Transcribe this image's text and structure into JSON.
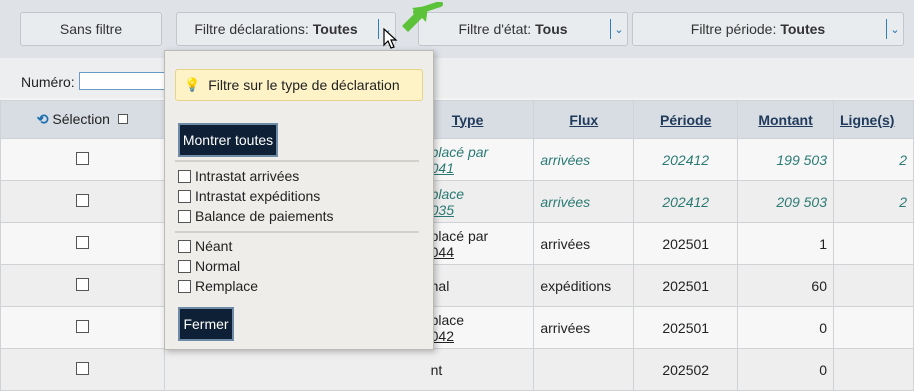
{
  "toolbar": {
    "no_filter": "Sans filtre",
    "decl_label": "Filtre déclarations:",
    "decl_value": "Toutes",
    "state_label": "Filtre d'état:",
    "state_value": "Tous",
    "period_label": "Filtre période:",
    "period_value": "Toutes",
    "chevron": "⌄⌄"
  },
  "number_label": "Numéro:",
  "table": {
    "headers": {
      "selection": "Sélection",
      "type": "Type",
      "flux": "Flux",
      "periode": "Période",
      "montant": "Montant",
      "lignes": "Ligne(s)"
    },
    "rows": [
      {
        "type": "placé par",
        "type2": "041",
        "flux": "arrivées",
        "periode": "202412",
        "montant": "199 503",
        "lignes": "2",
        "italic": true
      },
      {
        "type": "place",
        "type2": "035",
        "flux": "arrivées",
        "periode": "202412",
        "montant": "209 503",
        "lignes": "2",
        "italic": true
      },
      {
        "type": "placé par",
        "type2": "044",
        "flux": "arrivées",
        "periode": "202501",
        "montant": "1",
        "lignes": "",
        "italic": false
      },
      {
        "type": "nal",
        "type2": "",
        "flux": "expéditions",
        "periode": "202501",
        "montant": "60",
        "lignes": "",
        "italic": false
      },
      {
        "type": "place",
        "type2": "042",
        "flux": "arrivées",
        "periode": "202501",
        "montant": "0",
        "lignes": "",
        "italic": false
      },
      {
        "type": "nt",
        "type2": "",
        "flux": "",
        "periode": "202502",
        "montant": "0",
        "lignes": "",
        "italic": false
      }
    ]
  },
  "popup": {
    "tip": "Filtre sur le type de déclaration",
    "show_all": "Montrer toutes",
    "options_a": [
      "Intrastat arrivées",
      "Intrastat expéditions",
      "Balance de paiements"
    ],
    "options_b": [
      "Néant",
      "Normal",
      "Remplace"
    ],
    "close": "Fermer"
  },
  "colors": {
    "accent": "#0e2035",
    "italic_text": "#2b7a74",
    "annotation_arrow": "#5cc23a"
  }
}
